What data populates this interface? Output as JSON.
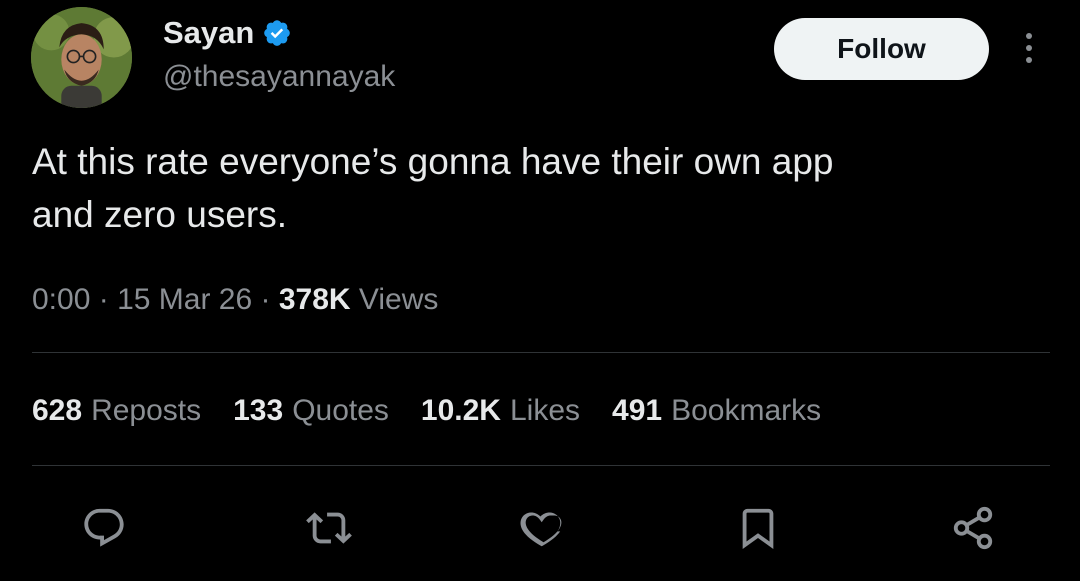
{
  "author": {
    "display_name": "Sayan",
    "handle": "@thesayannayak",
    "verified": true,
    "verified_color": "#1d9bf0"
  },
  "follow_label": "Follow",
  "tweet": {
    "text": "At this rate everyone’s gonna have their own app\nand zero users.",
    "time": "0:00",
    "separator": "·",
    "date": "15 Mar 26",
    "views_count": "378K",
    "views_label": "Views"
  },
  "stats": [
    {
      "count": "628",
      "label": "Reposts"
    },
    {
      "count": "133",
      "label": "Quotes"
    },
    {
      "count": "10.2K",
      "label": "Likes"
    },
    {
      "count": "491",
      "label": "Bookmarks"
    }
  ],
  "actions": [
    {
      "icon": "reply-icon"
    },
    {
      "icon": "repost-icon"
    },
    {
      "icon": "like-icon"
    },
    {
      "icon": "bookmark-icon"
    },
    {
      "icon": "share-icon"
    }
  ],
  "colors": {
    "background": "#000000",
    "primary_text": "#e7e9ea",
    "secondary_text": "#8b8f94",
    "divider": "#2f3336",
    "follow_bg": "#eff3f4"
  }
}
